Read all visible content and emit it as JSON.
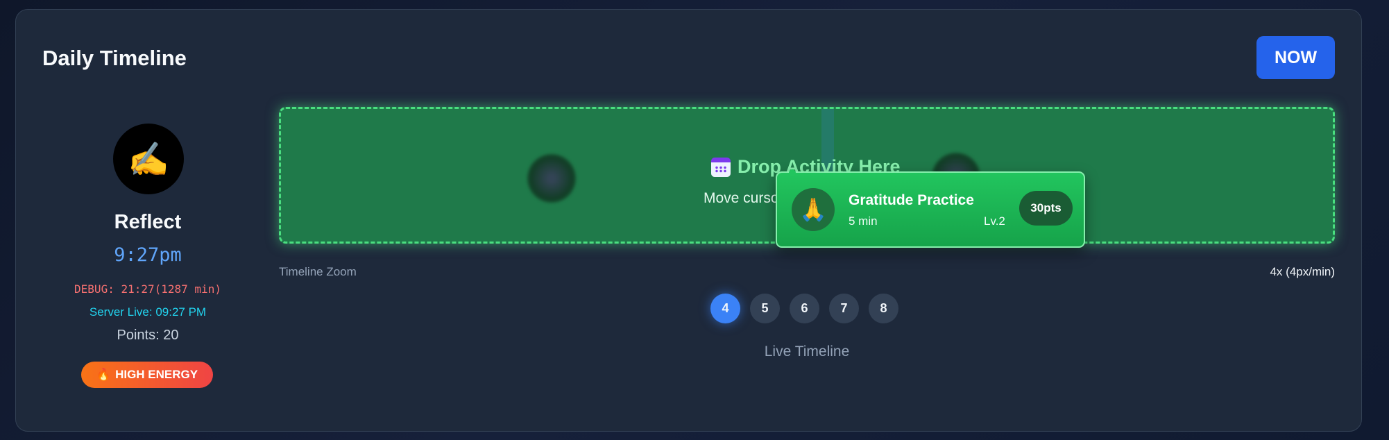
{
  "header": {
    "title": "Daily Timeline",
    "now_label": "NOW"
  },
  "current_activity": {
    "icon": "writing-hand-icon",
    "icon_glyph": "✍️",
    "name": "Reflect",
    "time": "9:27pm",
    "debug": "DEBUG: 21:27(1287 min)",
    "server_live": "Server Live: 09:27 PM",
    "points": "Points: 20",
    "energy_icon_glyph": "🔥",
    "energy_label": "HIGH ENERGY"
  },
  "timeline": {
    "drop_title": "Drop Activity Here",
    "drop_subtitle": "Move cursor over timeline"
  },
  "dragged_activity": {
    "icon": "folded-hands-icon",
    "icon_glyph": "🙏",
    "name": "Gratitude Practice",
    "duration": "5 min",
    "level": "Lv.2",
    "points": "30pts"
  },
  "zoom": {
    "label": "Timeline Zoom",
    "value": "4x (4px/min)",
    "options": [
      "4",
      "5",
      "6",
      "7",
      "8"
    ],
    "selected": "4"
  },
  "footer": {
    "live_label": "Live Timeline"
  },
  "colors": {
    "accent": "#2563eb",
    "drop_zone": "#1f7a4a",
    "drop_border": "#4ade80",
    "debug": "#f87171",
    "server": "#22d3ee"
  }
}
